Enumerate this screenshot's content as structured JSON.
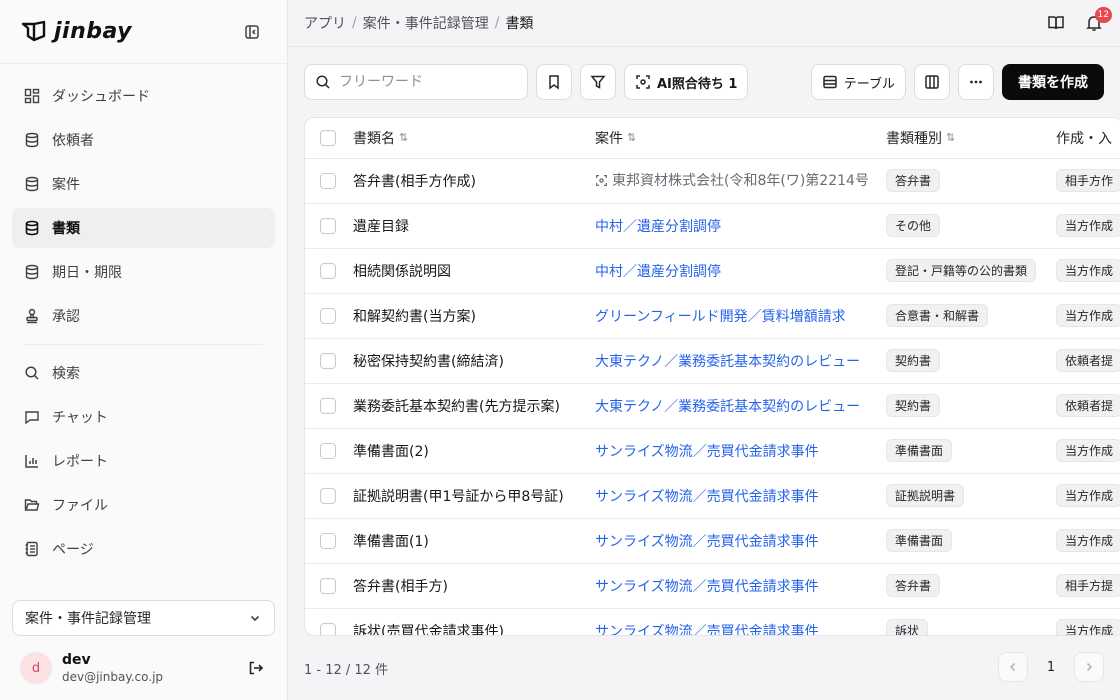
{
  "brand": {
    "name": "jinbay"
  },
  "sidebar": {
    "items": [
      {
        "label": "ダッシュボード",
        "icon": "dashboard-icon",
        "active": false
      },
      {
        "label": "依頼者",
        "icon": "database-icon",
        "active": false
      },
      {
        "label": "案件",
        "icon": "database-icon",
        "active": false
      },
      {
        "label": "書類",
        "icon": "database-icon",
        "active": true
      },
      {
        "label": "期日・期限",
        "icon": "database-icon",
        "active": false
      },
      {
        "label": "承認",
        "icon": "stamp-icon",
        "active": false
      }
    ],
    "secondary": [
      {
        "label": "検索",
        "icon": "search-icon"
      },
      {
        "label": "チャット",
        "icon": "chat-icon"
      },
      {
        "label": "レポート",
        "icon": "chart-icon"
      },
      {
        "label": "ファイル",
        "icon": "folder-icon"
      },
      {
        "label": "ページ",
        "icon": "notebook-icon"
      }
    ],
    "workspace": "案件・事件記録管理",
    "user": {
      "initial": "d",
      "name": "dev",
      "email": "dev@jinbay.co.jp"
    }
  },
  "breadcrumb": [
    "アプリ",
    "案件・事件記録管理",
    "書類"
  ],
  "notifications": {
    "count": "12"
  },
  "toolbar": {
    "search_placeholder": "フリーワード",
    "ai_label": "AI照合待ち 1",
    "table_label": "テーブル",
    "create_label": "書類を作成"
  },
  "table": {
    "columns": [
      "書類名",
      "案件",
      "書類種別",
      "作成・入"
    ],
    "rows": [
      {
        "name": "答弁書(相手方作成)",
        "case": "東邦資材株式会社(令和8年(ワ)第2214号",
        "case_pending": true,
        "type": "答弁書",
        "origin": "相手方作"
      },
      {
        "name": "遺産目録",
        "case": "中村／遺産分割調停",
        "case_pending": false,
        "type": "その他",
        "origin": "当方作成"
      },
      {
        "name": "相続関係説明図",
        "case": "中村／遺産分割調停",
        "case_pending": false,
        "type": "登記・戸籍等の公的書類",
        "origin": "当方作成"
      },
      {
        "name": "和解契約書(当方案)",
        "case": "グリーンフィールド開発／賃料増額請求",
        "case_pending": false,
        "type": "合意書・和解書",
        "origin": "当方作成"
      },
      {
        "name": "秘密保持契約書(締結済)",
        "case": "大東テクノ／業務委託基本契約のレビュー",
        "case_pending": false,
        "type": "契約書",
        "origin": "依頼者提"
      },
      {
        "name": "業務委託基本契約書(先方提示案)",
        "case": "大東テクノ／業務委託基本契約のレビュー",
        "case_pending": false,
        "type": "契約書",
        "origin": "依頼者提"
      },
      {
        "name": "準備書面(2)",
        "case": "サンライズ物流／売買代金請求事件",
        "case_pending": false,
        "type": "準備書面",
        "origin": "当方作成"
      },
      {
        "name": "証拠説明書(甲1号証から甲8号証)",
        "case": "サンライズ物流／売買代金請求事件",
        "case_pending": false,
        "type": "証拠説明書",
        "origin": "当方作成"
      },
      {
        "name": "準備書面(1)",
        "case": "サンライズ物流／売買代金請求事件",
        "case_pending": false,
        "type": "準備書面",
        "origin": "当方作成"
      },
      {
        "name": "答弁書(相手方)",
        "case": "サンライズ物流／売買代金請求事件",
        "case_pending": false,
        "type": "答弁書",
        "origin": "相手方提"
      },
      {
        "name": "訴状(売買代金請求事件)",
        "case": "サンライズ物流／売買代金請求事件",
        "case_pending": false,
        "type": "訴状",
        "origin": "当方作成"
      }
    ]
  },
  "footer": {
    "count": "1 - 12 / 12 件",
    "page": "1"
  }
}
